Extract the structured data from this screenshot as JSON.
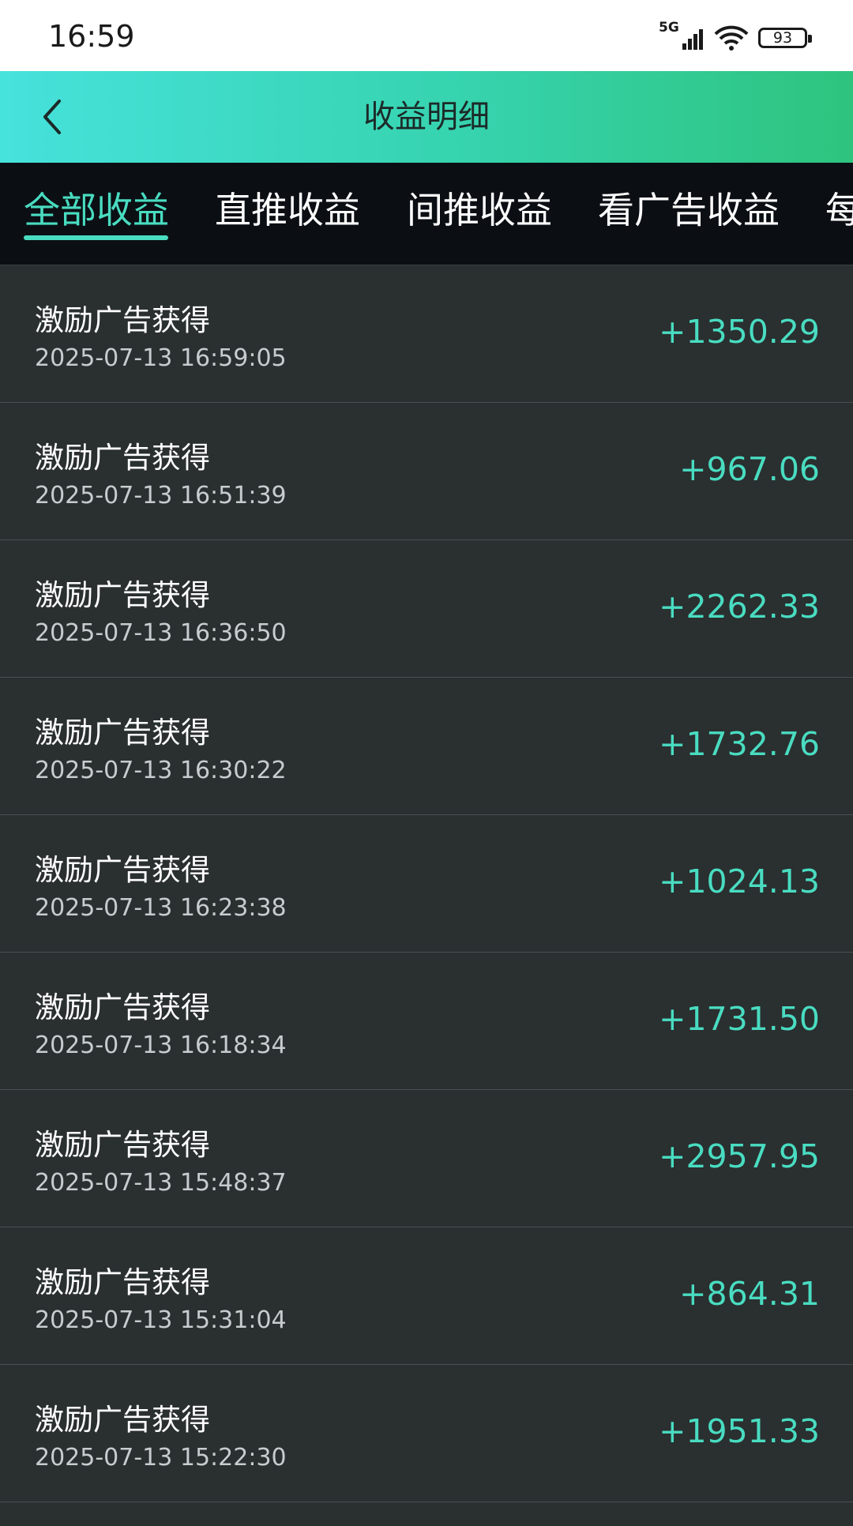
{
  "status_bar": {
    "time": "16:59",
    "network": "5G",
    "battery": "93"
  },
  "header": {
    "title": "收益明细",
    "back_icon": "chevron-left-icon"
  },
  "tabs": [
    {
      "label": "全部收益",
      "active": true
    },
    {
      "label": "直推收益",
      "active": false
    },
    {
      "label": "间推收益",
      "active": false
    },
    {
      "label": "看广告收益",
      "active": false
    },
    {
      "label": "每",
      "active": false
    }
  ],
  "records": [
    {
      "title": "激励广告获得",
      "time": "2025-07-13 16:59:05",
      "amount": "+1350.29"
    },
    {
      "title": "激励广告获得",
      "time": "2025-07-13 16:51:39",
      "amount": "+967.06"
    },
    {
      "title": "激励广告获得",
      "time": "2025-07-13 16:36:50",
      "amount": "+2262.33"
    },
    {
      "title": "激励广告获得",
      "time": "2025-07-13 16:30:22",
      "amount": "+1732.76"
    },
    {
      "title": "激励广告获得",
      "time": "2025-07-13 16:23:38",
      "amount": "+1024.13"
    },
    {
      "title": "激励广告获得",
      "time": "2025-07-13 16:18:34",
      "amount": "+1731.50"
    },
    {
      "title": "激励广告获得",
      "time": "2025-07-13 15:48:37",
      "amount": "+2957.95"
    },
    {
      "title": "激励广告获得",
      "time": "2025-07-13 15:31:04",
      "amount": "+864.31"
    },
    {
      "title": "激励广告获得",
      "time": "2025-07-13 15:22:30",
      "amount": "+1951.33"
    }
  ],
  "colors": {
    "accent": "#49dcc1",
    "background": "#2a2f30",
    "tab_bar": "#0b0f14"
  }
}
